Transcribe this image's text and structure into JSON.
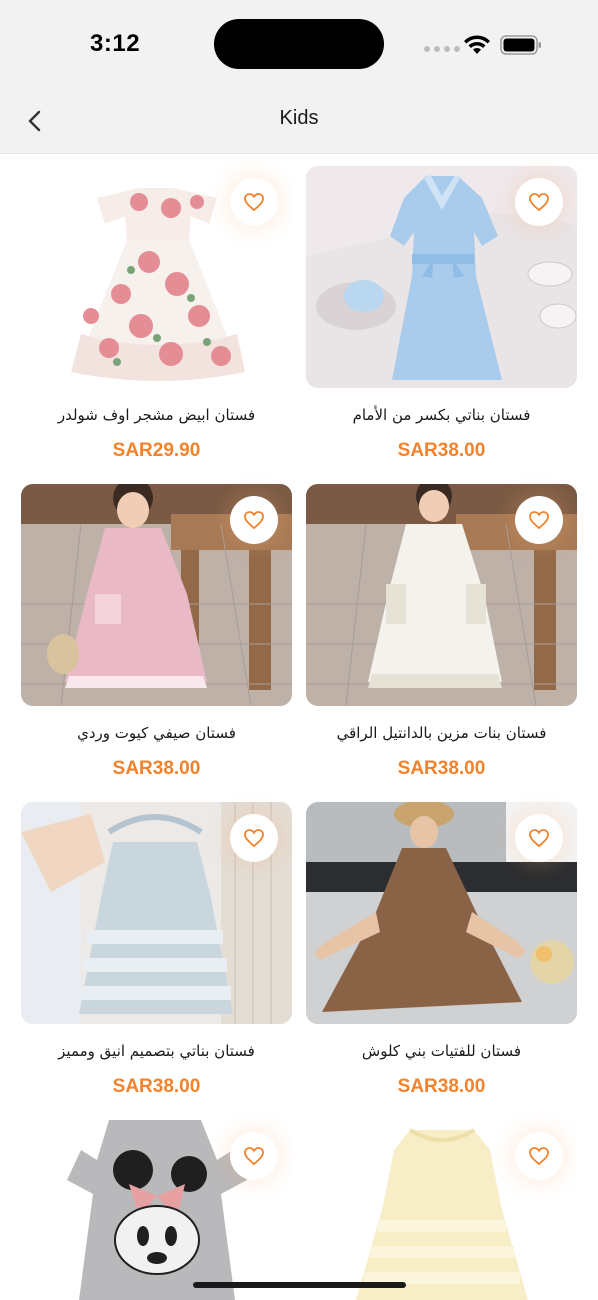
{
  "status_bar": {
    "time": "3:12"
  },
  "nav": {
    "title": "Kids",
    "back_icon": "chevron-left-icon"
  },
  "colors": {
    "accent": "#f2822b",
    "background": "#f2f2f2"
  },
  "products": [
    {
      "name": "فستان ابيض مشجر اوف شولدر",
      "price": "SAR29.90",
      "image": "white floral off-shoulder dress"
    },
    {
      "name": "فستان بناتي بكسر من الأمام",
      "price": "SAR38.00",
      "image": "light blue pleated dress with bow"
    },
    {
      "name": "فستان صيفي كيوت وردي",
      "price": "SAR38.00",
      "image": "girl in pink sleeveless dress"
    },
    {
      "name": "فستان بنات مزين بالدانتيل الراقي",
      "price": "SAR38.00",
      "image": "girl in white lace-trim dress"
    },
    {
      "name": "فستان بناتي بتصميم انيق ومميز",
      "price": "SAR38.00",
      "image": "light blue halter dress on hanger"
    },
    {
      "name": "فستان للفتيات بني كلوش",
      "price": "SAR38.00",
      "image": "girl in brown flared dress"
    },
    {
      "name": "",
      "price": "",
      "image": "grey t-shirt dress with mouse print"
    },
    {
      "name": "",
      "price": "",
      "image": "pale yellow ruffled dress"
    }
  ]
}
